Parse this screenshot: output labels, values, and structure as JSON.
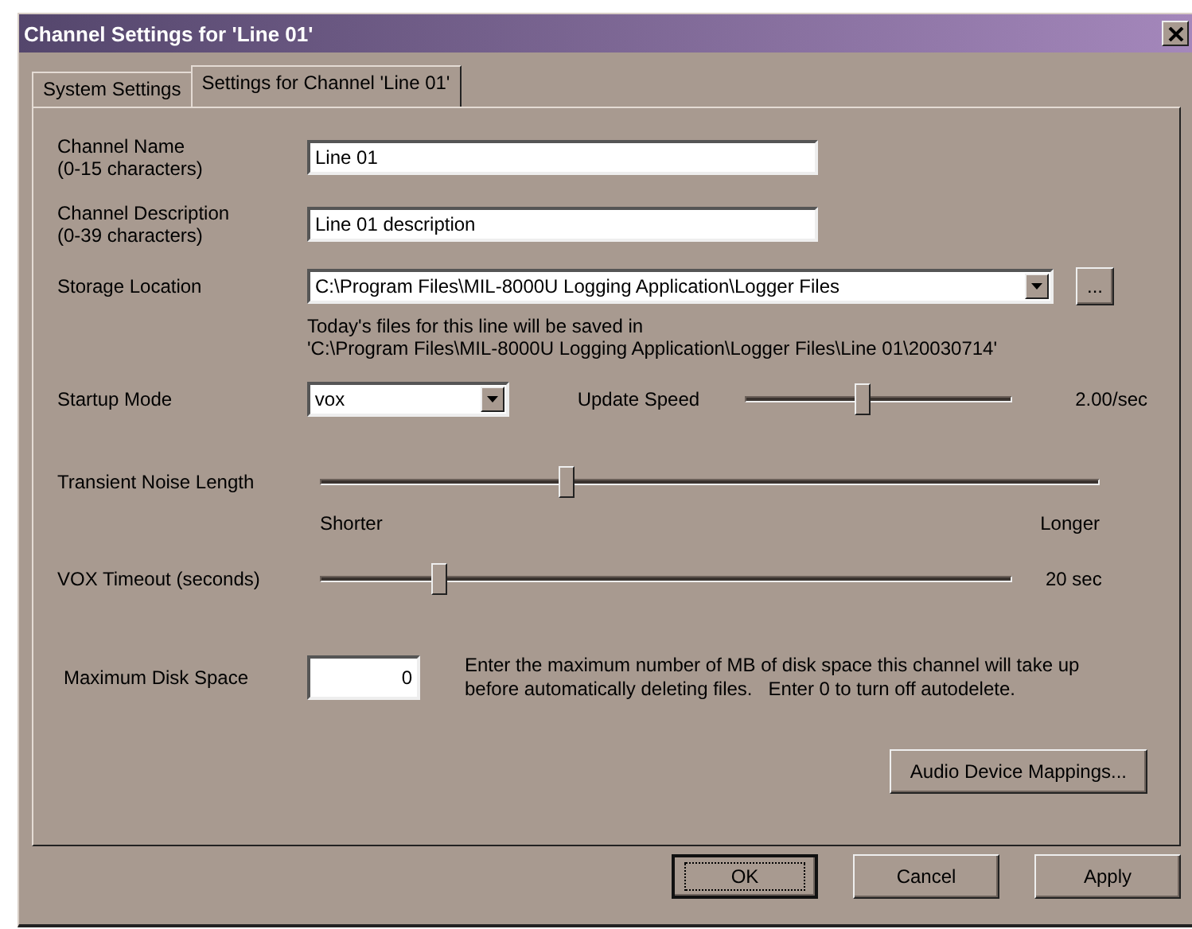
{
  "window": {
    "title": "Channel Settings for 'Line 01'"
  },
  "tabs": [
    {
      "label": "System Settings",
      "selected": false
    },
    {
      "label": "Settings for Channel 'Line 01'",
      "selected": true
    }
  ],
  "channel_name": {
    "label": "Channel Name",
    "hint": "(0-15 characters)",
    "value": "Line 01"
  },
  "channel_description": {
    "label": "Channel Description",
    "hint": "(0-39 characters)",
    "value": "Line 01 description"
  },
  "storage_location": {
    "label": "Storage Location",
    "value": "C:\\Program Files\\MIL-8000U Logging Application\\Logger Files",
    "browse": "...",
    "note_lines": [
      "Today's files for this line will be saved in",
      "'C:\\Program Files\\MIL-8000U Logging Application\\Logger Files\\Line 01\\20030714'"
    ]
  },
  "startup_mode": {
    "label": "Startup Mode",
    "value": "vox"
  },
  "update_speed": {
    "label": "Update Speed",
    "level": 0.44,
    "reading": "2.00/sec"
  },
  "transient_noise": {
    "label": "Transient Noise Length",
    "level": 0.315,
    "min_label": "Shorter",
    "max_label": "Longer"
  },
  "vox_timeout": {
    "label": "VOX Timeout (seconds)",
    "level": 0.17,
    "reading": "20 sec"
  },
  "max_disk_space": {
    "label": "Maximum Disk Space",
    "value": "0",
    "help_lines": [
      "Enter the maximum number of MB of disk space this channel will take up",
      "before automatically deleting files.   Enter 0 to turn off autodelete."
    ]
  },
  "audio_button": "Audio Device Mappings...",
  "buttons": [
    {
      "label": "OK",
      "focused": true
    },
    {
      "label": "Cancel",
      "focused": false
    },
    {
      "label": "Apply",
      "focused": false
    }
  ]
}
